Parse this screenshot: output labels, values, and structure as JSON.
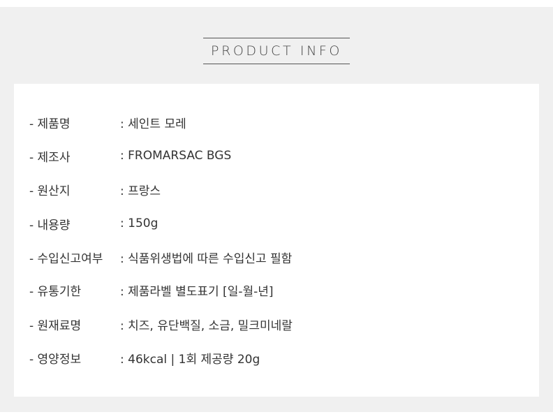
{
  "header": {
    "title": "PRODUCT INFO"
  },
  "info": {
    "rows": [
      {
        "label": "- 제품명",
        "value": ": 세인트 모레"
      },
      {
        "label": "- 제조사",
        "value": ": FROMARSAC BGS"
      },
      {
        "label": "- 원산지",
        "value": ": 프랑스"
      },
      {
        "label": "- 내용량",
        "value": ": 150g"
      },
      {
        "label": "- 수입신고여부",
        "value": ": 식품위생법에 따른 수입신고 필함"
      },
      {
        "label": "- 유통기한",
        "value": ": 제품라벨 별도표기 [일-월-년]"
      },
      {
        "label": "- 원재료명",
        "value": ": 치즈, 유단백질, 소금, 밀크미네랄"
      },
      {
        "label": "- 영양정보",
        "value": ": 46kcal | 1회 제공량 20g"
      }
    ]
  },
  "colors": {
    "background": "#f0f0f0",
    "card": "#ffffff",
    "text": "#333333",
    "title_rule": "#555555"
  }
}
